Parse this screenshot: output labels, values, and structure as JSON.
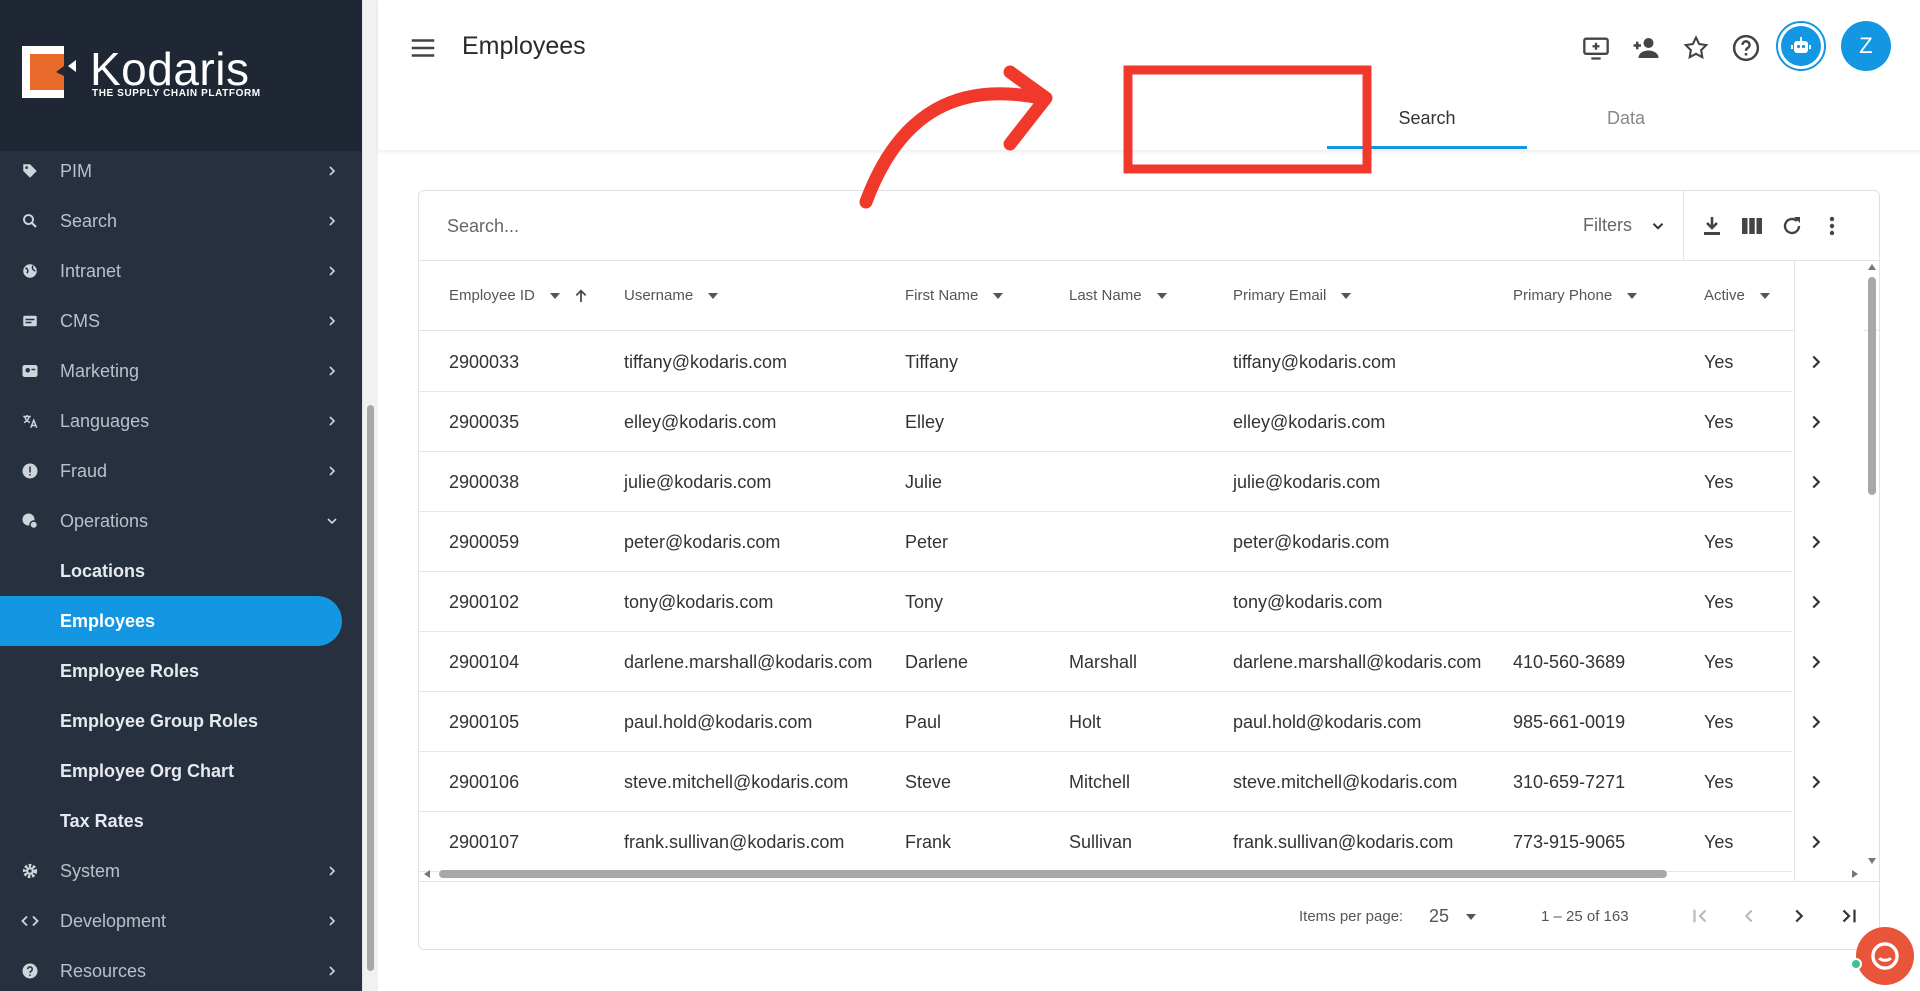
{
  "brand": {
    "name": "Kodaris",
    "tagline": "THE SUPPLY CHAIN PLATFORM"
  },
  "sidebar": {
    "items": [
      {
        "label": "PIM",
        "icon": "tag-icon",
        "expanded": false
      },
      {
        "label": "Search",
        "icon": "search-icon",
        "expanded": false
      },
      {
        "label": "Intranet",
        "icon": "globe-icon",
        "expanded": false
      },
      {
        "label": "CMS",
        "icon": "cms-icon",
        "expanded": false
      },
      {
        "label": "Marketing",
        "icon": "marketing-icon",
        "expanded": false
      },
      {
        "label": "Languages",
        "icon": "translate-icon",
        "expanded": false
      },
      {
        "label": "Fraud",
        "icon": "alert-icon",
        "expanded": false
      },
      {
        "label": "Operations",
        "icon": "operations-icon",
        "expanded": true
      }
    ],
    "operations_children": [
      {
        "label": "Locations",
        "active": false
      },
      {
        "label": "Employees",
        "active": true
      },
      {
        "label": "Employee Roles",
        "active": false
      },
      {
        "label": "Employee Group Roles",
        "active": false
      },
      {
        "label": "Employee Org Chart",
        "active": false
      },
      {
        "label": "Tax Rates",
        "active": false
      }
    ],
    "items_after": [
      {
        "label": "System",
        "icon": "gear-icon",
        "expanded": false
      },
      {
        "label": "Development",
        "icon": "code-icon",
        "expanded": false
      },
      {
        "label": "Resources",
        "icon": "help-icon",
        "expanded": false
      }
    ]
  },
  "header": {
    "title": "Employees",
    "avatar_letter": "Z",
    "tabs": [
      {
        "label": "Search",
        "active": true
      },
      {
        "label": "Data",
        "active": false
      }
    ]
  },
  "toolbar": {
    "search_placeholder": "Search...",
    "filters_label": "Filters"
  },
  "table": {
    "columns": [
      "Employee ID",
      "Username",
      "First Name",
      "Last Name",
      "Primary Email",
      "Primary Phone",
      "Active"
    ],
    "rows": [
      [
        "2900033",
        "tiffany@kodaris.com",
        "Tiffany",
        "",
        "tiffany@kodaris.com",
        "",
        "Yes"
      ],
      [
        "2900035",
        "elley@kodaris.com",
        "Elley",
        "",
        "elley@kodaris.com",
        "",
        "Yes"
      ],
      [
        "2900038",
        "julie@kodaris.com",
        "Julie",
        "",
        "julie@kodaris.com",
        "",
        "Yes"
      ],
      [
        "2900059",
        "peter@kodaris.com",
        "Peter",
        "",
        "peter@kodaris.com",
        "",
        "Yes"
      ],
      [
        "2900102",
        "tony@kodaris.com",
        "Tony",
        "",
        "tony@kodaris.com",
        "",
        "Yes"
      ],
      [
        "2900104",
        "darlene.marshall@kodaris.com",
        "Darlene",
        "Marshall",
        "darlene.marshall@kodaris.com",
        "410-560-3689",
        "Yes"
      ],
      [
        "2900105",
        "paul.hold@kodaris.com",
        "Paul",
        "Holt",
        "paul.hold@kodaris.com",
        "985-661-0019",
        "Yes"
      ],
      [
        "2900106",
        "steve.mitchell@kodaris.com",
        "Steve",
        "Mitchell",
        "steve.mitchell@kodaris.com",
        "310-659-7271",
        "Yes"
      ],
      [
        "2900107",
        "frank.sullivan@kodaris.com",
        "Frank",
        "Sullivan",
        "frank.sullivan@kodaris.com",
        "773-915-9065",
        "Yes"
      ]
    ]
  },
  "paginator": {
    "items_per_page_label": "Items per page:",
    "items_per_page": "25",
    "range_label": "1 – 25 of 163"
  },
  "colors": {
    "accent": "#1497e2",
    "sidebar_bg": "#27303f",
    "annotation": "#f0392b",
    "brand_orange": "#e8692a"
  }
}
